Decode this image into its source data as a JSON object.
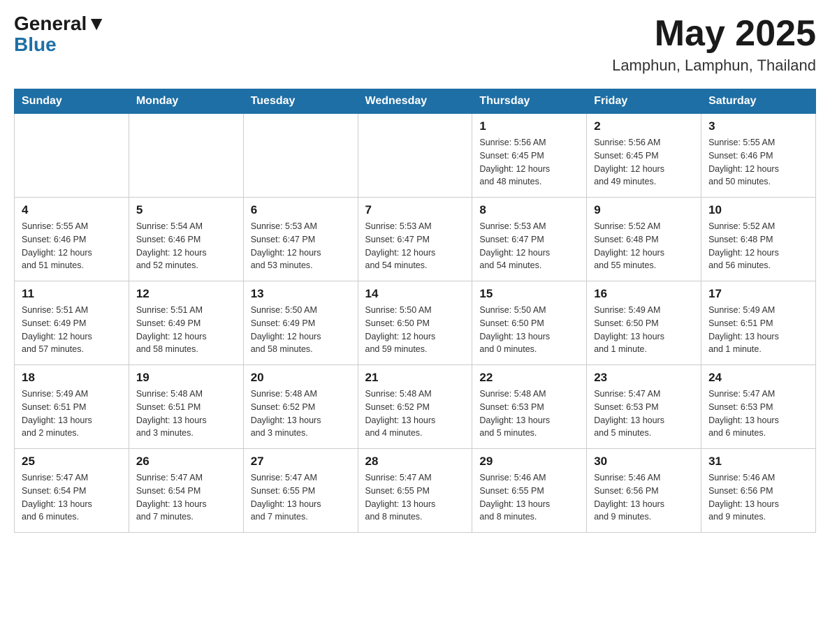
{
  "header": {
    "logo_general": "General",
    "logo_blue": "Blue",
    "month_title": "May 2025",
    "location": "Lamphun, Lamphun, Thailand"
  },
  "days_of_week": [
    "Sunday",
    "Monday",
    "Tuesday",
    "Wednesday",
    "Thursday",
    "Friday",
    "Saturday"
  ],
  "weeks": [
    [
      {
        "day": "",
        "info": ""
      },
      {
        "day": "",
        "info": ""
      },
      {
        "day": "",
        "info": ""
      },
      {
        "day": "",
        "info": ""
      },
      {
        "day": "1",
        "info": "Sunrise: 5:56 AM\nSunset: 6:45 PM\nDaylight: 12 hours\nand 48 minutes."
      },
      {
        "day": "2",
        "info": "Sunrise: 5:56 AM\nSunset: 6:45 PM\nDaylight: 12 hours\nand 49 minutes."
      },
      {
        "day": "3",
        "info": "Sunrise: 5:55 AM\nSunset: 6:46 PM\nDaylight: 12 hours\nand 50 minutes."
      }
    ],
    [
      {
        "day": "4",
        "info": "Sunrise: 5:55 AM\nSunset: 6:46 PM\nDaylight: 12 hours\nand 51 minutes."
      },
      {
        "day": "5",
        "info": "Sunrise: 5:54 AM\nSunset: 6:46 PM\nDaylight: 12 hours\nand 52 minutes."
      },
      {
        "day": "6",
        "info": "Sunrise: 5:53 AM\nSunset: 6:47 PM\nDaylight: 12 hours\nand 53 minutes."
      },
      {
        "day": "7",
        "info": "Sunrise: 5:53 AM\nSunset: 6:47 PM\nDaylight: 12 hours\nand 54 minutes."
      },
      {
        "day": "8",
        "info": "Sunrise: 5:53 AM\nSunset: 6:47 PM\nDaylight: 12 hours\nand 54 minutes."
      },
      {
        "day": "9",
        "info": "Sunrise: 5:52 AM\nSunset: 6:48 PM\nDaylight: 12 hours\nand 55 minutes."
      },
      {
        "day": "10",
        "info": "Sunrise: 5:52 AM\nSunset: 6:48 PM\nDaylight: 12 hours\nand 56 minutes."
      }
    ],
    [
      {
        "day": "11",
        "info": "Sunrise: 5:51 AM\nSunset: 6:49 PM\nDaylight: 12 hours\nand 57 minutes."
      },
      {
        "day": "12",
        "info": "Sunrise: 5:51 AM\nSunset: 6:49 PM\nDaylight: 12 hours\nand 58 minutes."
      },
      {
        "day": "13",
        "info": "Sunrise: 5:50 AM\nSunset: 6:49 PM\nDaylight: 12 hours\nand 58 minutes."
      },
      {
        "day": "14",
        "info": "Sunrise: 5:50 AM\nSunset: 6:50 PM\nDaylight: 12 hours\nand 59 minutes."
      },
      {
        "day": "15",
        "info": "Sunrise: 5:50 AM\nSunset: 6:50 PM\nDaylight: 13 hours\nand 0 minutes."
      },
      {
        "day": "16",
        "info": "Sunrise: 5:49 AM\nSunset: 6:50 PM\nDaylight: 13 hours\nand 1 minute."
      },
      {
        "day": "17",
        "info": "Sunrise: 5:49 AM\nSunset: 6:51 PM\nDaylight: 13 hours\nand 1 minute."
      }
    ],
    [
      {
        "day": "18",
        "info": "Sunrise: 5:49 AM\nSunset: 6:51 PM\nDaylight: 13 hours\nand 2 minutes."
      },
      {
        "day": "19",
        "info": "Sunrise: 5:48 AM\nSunset: 6:51 PM\nDaylight: 13 hours\nand 3 minutes."
      },
      {
        "day": "20",
        "info": "Sunrise: 5:48 AM\nSunset: 6:52 PM\nDaylight: 13 hours\nand 3 minutes."
      },
      {
        "day": "21",
        "info": "Sunrise: 5:48 AM\nSunset: 6:52 PM\nDaylight: 13 hours\nand 4 minutes."
      },
      {
        "day": "22",
        "info": "Sunrise: 5:48 AM\nSunset: 6:53 PM\nDaylight: 13 hours\nand 5 minutes."
      },
      {
        "day": "23",
        "info": "Sunrise: 5:47 AM\nSunset: 6:53 PM\nDaylight: 13 hours\nand 5 minutes."
      },
      {
        "day": "24",
        "info": "Sunrise: 5:47 AM\nSunset: 6:53 PM\nDaylight: 13 hours\nand 6 minutes."
      }
    ],
    [
      {
        "day": "25",
        "info": "Sunrise: 5:47 AM\nSunset: 6:54 PM\nDaylight: 13 hours\nand 6 minutes."
      },
      {
        "day": "26",
        "info": "Sunrise: 5:47 AM\nSunset: 6:54 PM\nDaylight: 13 hours\nand 7 minutes."
      },
      {
        "day": "27",
        "info": "Sunrise: 5:47 AM\nSunset: 6:55 PM\nDaylight: 13 hours\nand 7 minutes."
      },
      {
        "day": "28",
        "info": "Sunrise: 5:47 AM\nSunset: 6:55 PM\nDaylight: 13 hours\nand 8 minutes."
      },
      {
        "day": "29",
        "info": "Sunrise: 5:46 AM\nSunset: 6:55 PM\nDaylight: 13 hours\nand 8 minutes."
      },
      {
        "day": "30",
        "info": "Sunrise: 5:46 AM\nSunset: 6:56 PM\nDaylight: 13 hours\nand 9 minutes."
      },
      {
        "day": "31",
        "info": "Sunrise: 5:46 AM\nSunset: 6:56 PM\nDaylight: 13 hours\nand 9 minutes."
      }
    ]
  ]
}
